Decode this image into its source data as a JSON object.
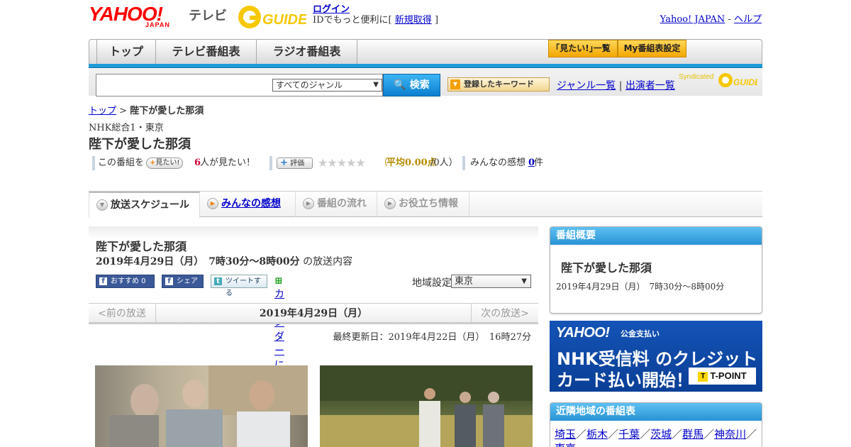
{
  "header": {
    "logo_yahoo": "YAHOO!",
    "logo_japan": "JAPAN",
    "logo_tv": "テレビ",
    "logo_gguide": "GUIDE",
    "login": "ログイン",
    "login_text": "IDでもっと便利に[",
    "signup": "新規取得",
    "login_close": "]",
    "top_links": [
      "Yahoo! JAPAN",
      "-",
      "ヘルプ"
    ]
  },
  "nav": {
    "tabs": [
      "トップ",
      "テレビ番組表",
      "ラジオ番組表"
    ],
    "btn_mitai": "｢見たい!｣一覧",
    "btn_my": "My番組表設定"
  },
  "search": {
    "genre": "すべてのジャンル",
    "button": "検索",
    "keyword_button": "登録したキーワード",
    "genre_list": "ジャンル一覧",
    "separator": "|",
    "performer_list": "出演者一覧",
    "syndicated": "Syndicated"
  },
  "breadcrumb": {
    "home": "トップ",
    "sep": " > ",
    "current": "陛下が愛した那須"
  },
  "program": {
    "channel": "NHK総合1・東京",
    "title": "陛下が愛した那須",
    "date_time": "2019年4月29日（月）　7時30分～8時00分",
    "date_suffix": "の放送内容",
    "updated": "最終更新日：2019年4月22日（月）　16時27分"
  },
  "rating": {
    "prefix": "この番組を",
    "mitai_btn": "見たい!",
    "mitai_count": "6",
    "mitai_suffix": "人が見たい！",
    "rate_btn": "評価",
    "stars": "★★★★★",
    "avg_open": "（",
    "avg": "平均0.00点",
    "avg_rest": "/0人）",
    "kanso_label": "みんなの感想",
    "kanso_count": "0",
    "kanso_suffix": "件"
  },
  "subtabs": [
    "放送スケジュール",
    "みんなの感想",
    "番組の流れ",
    "お役立ち情報"
  ],
  "social": {
    "fb_rec": "おすすめ 0",
    "fb_share": "シェア",
    "tweet": "ツイートする",
    "calendar": "カレンダーに登録"
  },
  "region": {
    "label": "地域設定",
    "value": "東京"
  },
  "date_nav": {
    "prev": "<前の放送",
    "current": "2019年4月29日（月）",
    "next": "次の放送>"
  },
  "sidebar": {
    "overview_title": "番組概要",
    "overview_program": "陛下が愛した那須",
    "overview_time": "2019年4月29日（月）　7時30分～8時00分",
    "ad_logo": "YAHOO!",
    "ad_logo_sub": "公金支払い",
    "ad_line1": "NHK受信料 のクレジット",
    "ad_line2": "カード払い開始！",
    "ad_tpoint": "T-POINT",
    "near_title": "近隣地域の番組表",
    "near_regions": [
      "埼玉",
      "栃木",
      "千葉",
      "茨城",
      "群馬",
      "神奈川",
      "東京"
    ]
  },
  "colors": {
    "accent_blue": "#1f9bd8",
    "link": "#0000cc",
    "orange": "#f3a700",
    "red_count": "#cc0033"
  }
}
